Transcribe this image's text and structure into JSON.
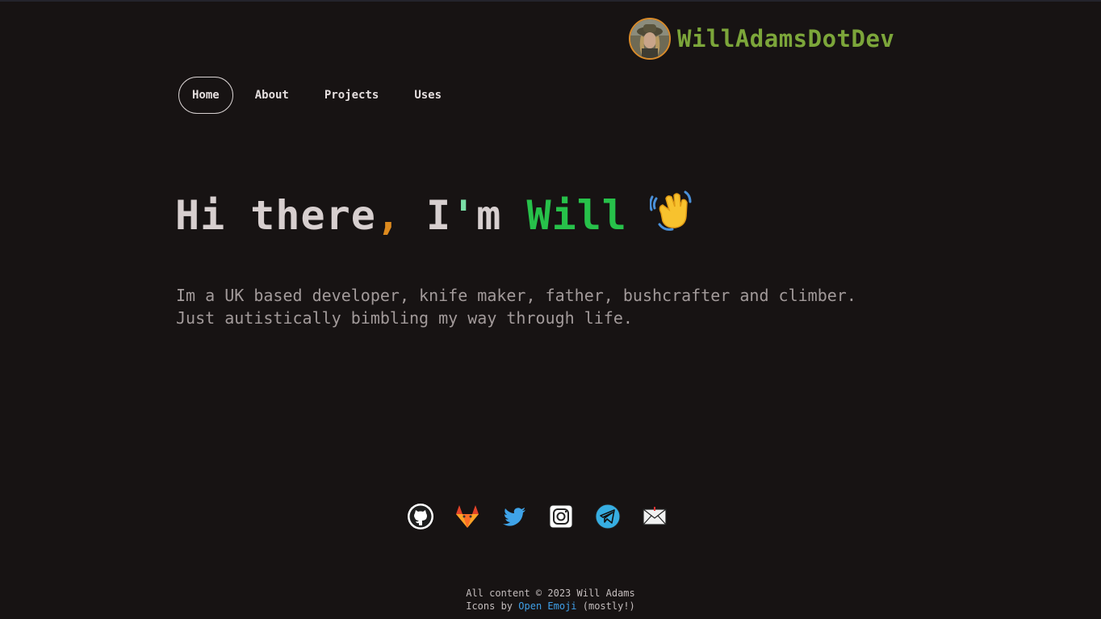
{
  "header": {
    "brand_name": "WillAdamsDotDev",
    "avatar_icon": "profile-photo",
    "accent_color": "#7ca63a"
  },
  "nav": {
    "items": [
      {
        "label": "Home",
        "active": true
      },
      {
        "label": "About",
        "active": false
      },
      {
        "label": "Projects",
        "active": false
      },
      {
        "label": "Uses",
        "active": false
      }
    ]
  },
  "hero": {
    "hi": "Hi there",
    "comma": ",",
    "im_start": " I",
    "apostrophe": "'",
    "im_end": "m ",
    "name": "Will",
    "emoji_icon": "waving-hand-icon"
  },
  "intro": {
    "line1": "Im a UK based developer, knife maker, father, bushcrafter and climber.",
    "line2": "Just autistically bimbling my way through life."
  },
  "socials": [
    {
      "icon": "github-icon"
    },
    {
      "icon": "gitlab-icon"
    },
    {
      "icon": "twitter-icon"
    },
    {
      "icon": "instagram-icon"
    },
    {
      "icon": "telegram-icon"
    },
    {
      "icon": "email-icon"
    }
  ],
  "footer": {
    "copyright": "All content © 2023 Will Adams",
    "icons_prefix": "Icons by ",
    "icons_link": "Open Emoji",
    "icons_suffix": " (mostly!)"
  }
}
